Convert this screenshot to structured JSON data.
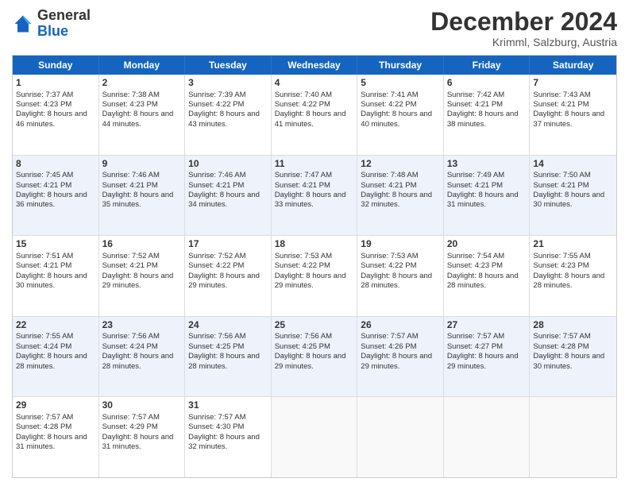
{
  "logo": {
    "general": "General",
    "blue": "Blue"
  },
  "header": {
    "month": "December 2024",
    "location": "Krimml, Salzburg, Austria"
  },
  "weekdays": [
    "Sunday",
    "Monday",
    "Tuesday",
    "Wednesday",
    "Thursday",
    "Friday",
    "Saturday"
  ],
  "rows": [
    [
      {
        "day": "1",
        "sunrise": "Sunrise: 7:37 AM",
        "sunset": "Sunset: 4:23 PM",
        "daylight": "Daylight: 8 hours and 46 minutes."
      },
      {
        "day": "2",
        "sunrise": "Sunrise: 7:38 AM",
        "sunset": "Sunset: 4:23 PM",
        "daylight": "Daylight: 8 hours and 44 minutes."
      },
      {
        "day": "3",
        "sunrise": "Sunrise: 7:39 AM",
        "sunset": "Sunset: 4:22 PM",
        "daylight": "Daylight: 8 hours and 43 minutes."
      },
      {
        "day": "4",
        "sunrise": "Sunrise: 7:40 AM",
        "sunset": "Sunset: 4:22 PM",
        "daylight": "Daylight: 8 hours and 41 minutes."
      },
      {
        "day": "5",
        "sunrise": "Sunrise: 7:41 AM",
        "sunset": "Sunset: 4:22 PM",
        "daylight": "Daylight: 8 hours and 40 minutes."
      },
      {
        "day": "6",
        "sunrise": "Sunrise: 7:42 AM",
        "sunset": "Sunset: 4:21 PM",
        "daylight": "Daylight: 8 hours and 38 minutes."
      },
      {
        "day": "7",
        "sunrise": "Sunrise: 7:43 AM",
        "sunset": "Sunset: 4:21 PM",
        "daylight": "Daylight: 8 hours and 37 minutes."
      }
    ],
    [
      {
        "day": "8",
        "sunrise": "Sunrise: 7:45 AM",
        "sunset": "Sunset: 4:21 PM",
        "daylight": "Daylight: 8 hours and 36 minutes."
      },
      {
        "day": "9",
        "sunrise": "Sunrise: 7:46 AM",
        "sunset": "Sunset: 4:21 PM",
        "daylight": "Daylight: 8 hours and 35 minutes."
      },
      {
        "day": "10",
        "sunrise": "Sunrise: 7:46 AM",
        "sunset": "Sunset: 4:21 PM",
        "daylight": "Daylight: 8 hours and 34 minutes."
      },
      {
        "day": "11",
        "sunrise": "Sunrise: 7:47 AM",
        "sunset": "Sunset: 4:21 PM",
        "daylight": "Daylight: 8 hours and 33 minutes."
      },
      {
        "day": "12",
        "sunrise": "Sunrise: 7:48 AM",
        "sunset": "Sunset: 4:21 PM",
        "daylight": "Daylight: 8 hours and 32 minutes."
      },
      {
        "day": "13",
        "sunrise": "Sunrise: 7:49 AM",
        "sunset": "Sunset: 4:21 PM",
        "daylight": "Daylight: 8 hours and 31 minutes."
      },
      {
        "day": "14",
        "sunrise": "Sunrise: 7:50 AM",
        "sunset": "Sunset: 4:21 PM",
        "daylight": "Daylight: 8 hours and 30 minutes."
      }
    ],
    [
      {
        "day": "15",
        "sunrise": "Sunrise: 7:51 AM",
        "sunset": "Sunset: 4:21 PM",
        "daylight": "Daylight: 8 hours and 30 minutes."
      },
      {
        "day": "16",
        "sunrise": "Sunrise: 7:52 AM",
        "sunset": "Sunset: 4:21 PM",
        "daylight": "Daylight: 8 hours and 29 minutes."
      },
      {
        "day": "17",
        "sunrise": "Sunrise: 7:52 AM",
        "sunset": "Sunset: 4:22 PM",
        "daylight": "Daylight: 8 hours and 29 minutes."
      },
      {
        "day": "18",
        "sunrise": "Sunrise: 7:53 AM",
        "sunset": "Sunset: 4:22 PM",
        "daylight": "Daylight: 8 hours and 29 minutes."
      },
      {
        "day": "19",
        "sunrise": "Sunrise: 7:53 AM",
        "sunset": "Sunset: 4:22 PM",
        "daylight": "Daylight: 8 hours and 28 minutes."
      },
      {
        "day": "20",
        "sunrise": "Sunrise: 7:54 AM",
        "sunset": "Sunset: 4:23 PM",
        "daylight": "Daylight: 8 hours and 28 minutes."
      },
      {
        "day": "21",
        "sunrise": "Sunrise: 7:55 AM",
        "sunset": "Sunset: 4:23 PM",
        "daylight": "Daylight: 8 hours and 28 minutes."
      }
    ],
    [
      {
        "day": "22",
        "sunrise": "Sunrise: 7:55 AM",
        "sunset": "Sunset: 4:24 PM",
        "daylight": "Daylight: 8 hours and 28 minutes."
      },
      {
        "day": "23",
        "sunrise": "Sunrise: 7:56 AM",
        "sunset": "Sunset: 4:24 PM",
        "daylight": "Daylight: 8 hours and 28 minutes."
      },
      {
        "day": "24",
        "sunrise": "Sunrise: 7:56 AM",
        "sunset": "Sunset: 4:25 PM",
        "daylight": "Daylight: 8 hours and 28 minutes."
      },
      {
        "day": "25",
        "sunrise": "Sunrise: 7:56 AM",
        "sunset": "Sunset: 4:25 PM",
        "daylight": "Daylight: 8 hours and 29 minutes."
      },
      {
        "day": "26",
        "sunrise": "Sunrise: 7:57 AM",
        "sunset": "Sunset: 4:26 PM",
        "daylight": "Daylight: 8 hours and 29 minutes."
      },
      {
        "day": "27",
        "sunrise": "Sunrise: 7:57 AM",
        "sunset": "Sunset: 4:27 PM",
        "daylight": "Daylight: 8 hours and 29 minutes."
      },
      {
        "day": "28",
        "sunrise": "Sunrise: 7:57 AM",
        "sunset": "Sunset: 4:28 PM",
        "daylight": "Daylight: 8 hours and 30 minutes."
      }
    ],
    [
      {
        "day": "29",
        "sunrise": "Sunrise: 7:57 AM",
        "sunset": "Sunset: 4:28 PM",
        "daylight": "Daylight: 8 hours and 31 minutes."
      },
      {
        "day": "30",
        "sunrise": "Sunrise: 7:57 AM",
        "sunset": "Sunset: 4:29 PM",
        "daylight": "Daylight: 8 hours and 31 minutes."
      },
      {
        "day": "31",
        "sunrise": "Sunrise: 7:57 AM",
        "sunset": "Sunset: 4:30 PM",
        "daylight": "Daylight: 8 hours and 32 minutes."
      },
      {
        "day": "",
        "sunrise": "",
        "sunset": "",
        "daylight": ""
      },
      {
        "day": "",
        "sunrise": "",
        "sunset": "",
        "daylight": ""
      },
      {
        "day": "",
        "sunrise": "",
        "sunset": "",
        "daylight": ""
      },
      {
        "day": "",
        "sunrise": "",
        "sunset": "",
        "daylight": ""
      }
    ]
  ]
}
